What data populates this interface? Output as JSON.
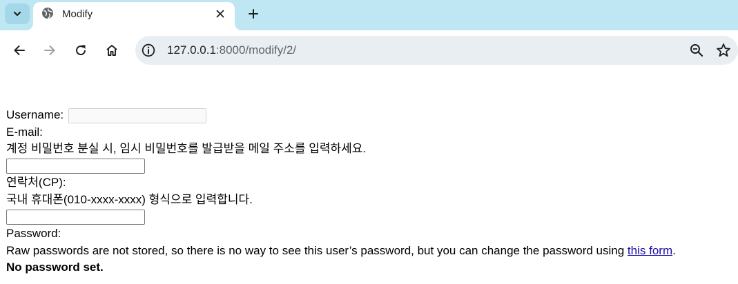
{
  "browser": {
    "tab": {
      "title": "Modify"
    },
    "address": {
      "host": "127.0.0.1",
      "rest": ":8000/modify/2/"
    }
  },
  "form": {
    "username_label": "Username:",
    "email_label": "E-mail:",
    "email_help": "계정 비밀번호 분실 시, 임시 비밀번호를 발급받을 메일 주소를 입력하세요.",
    "phone_label": "연락처(CP):",
    "phone_help": "국내 휴대폰(010-xxxx-xxxx) 형식으로 입력합니다.",
    "password_label": "Password:",
    "password_help": "Raw passwords are not stored, so there is no way to see this user’s password, but you can change the password using ",
    "password_link": "this form",
    "password_help_end": ".",
    "password_status": "No password set."
  },
  "icons": {
    "tab_search": "chevron-down-icon",
    "favicon": "globe-icon",
    "tab_close": "close-icon",
    "new_tab": "plus-icon",
    "back": "arrow-left-icon",
    "forward": "arrow-right-icon",
    "reload": "reload-icon",
    "home": "home-icon",
    "site_info": "info-icon",
    "zoom": "zoom-out-icon",
    "bookmark": "star-icon"
  },
  "colors": {
    "tabstrip": "#bfe6f3",
    "omnibox": "#e9eef2",
    "link": "#1a0dab"
  }
}
